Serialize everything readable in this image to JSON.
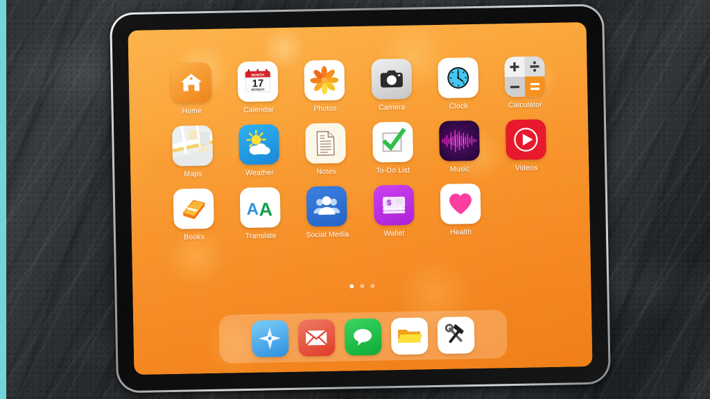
{
  "device": {
    "type": "tablet",
    "frame_color": "#b9bec2",
    "bezel_color": "#101010"
  },
  "backdrop": {
    "texture": "dark-slate-stone",
    "base_color": "#2e3134",
    "accent_strip_color": "#73d4dc"
  },
  "wallpaper": {
    "style": "orange-bokeh",
    "color_start": "#fcb34a",
    "color_end": "#f07d14"
  },
  "home_screen": {
    "rows": [
      [
        {
          "label": "Home",
          "icon": "home-icon",
          "tile_bg": "#f5902a"
        },
        {
          "label": "Calendar",
          "icon": "calendar-icon",
          "tile_bg": "#ffffff"
        },
        {
          "label": "Photos",
          "icon": "photos-icon",
          "tile_bg": "#ffffff"
        },
        {
          "label": "Camera",
          "icon": "camera-icon",
          "tile_bg": "#d8d8d8"
        },
        {
          "label": "Clock",
          "icon": "clock-icon",
          "tile_bg": "#ffffff"
        },
        {
          "label": "Calculator",
          "icon": "calculator-icon",
          "tile_bg": "#e8e8e8"
        }
      ],
      [
        {
          "label": "Maps",
          "icon": "maps-icon",
          "tile_bg": "#eceff0"
        },
        {
          "label": "Weather",
          "icon": "weather-icon",
          "tile_bg": "#23a4e8"
        },
        {
          "label": "Notes",
          "icon": "notes-icon",
          "tile_bg": "#fdf6e6"
        },
        {
          "label": "To-Do List",
          "icon": "checkbox-icon",
          "tile_bg": "#ffffff"
        },
        {
          "label": "Music",
          "icon": "music-icon",
          "tile_bg": "#2b0a3d"
        },
        {
          "label": "Videos",
          "icon": "video-play-icon",
          "tile_bg": "#e8192c"
        }
      ],
      [
        {
          "label": "Books",
          "icon": "book-icon",
          "tile_bg": "#ffffff"
        },
        {
          "label": "Translate",
          "icon": "translate-icon",
          "tile_bg": "#ffffff"
        },
        {
          "label": "Social Media",
          "icon": "people-icon",
          "tile_bg": "#2a6fd4"
        },
        {
          "label": "Wallet",
          "icon": "wallet-icon",
          "tile_bg": "#c233e8"
        },
        {
          "label": "Health",
          "icon": "heart-icon",
          "tile_bg": "#ffffff"
        }
      ]
    ],
    "calendar_tile": {
      "header": "MONTH",
      "day_number": "17",
      "weekday": "MONDAY"
    },
    "page_dots": {
      "count": 3,
      "active_index": 0
    },
    "dock": [
      {
        "name": "Safari",
        "icon": "compass-icon",
        "tile_bg": "#3aa6ef"
      },
      {
        "name": "Mail",
        "icon": "envelope-icon",
        "tile_bg": "#e8503a"
      },
      {
        "name": "Messages",
        "icon": "chat-icon",
        "tile_bg": "#22c04a"
      },
      {
        "name": "Files",
        "icon": "folder-icon",
        "tile_bg": "#ffffff"
      },
      {
        "name": "Tools",
        "icon": "tools-icon",
        "tile_bg": "#ffffff"
      }
    ]
  }
}
